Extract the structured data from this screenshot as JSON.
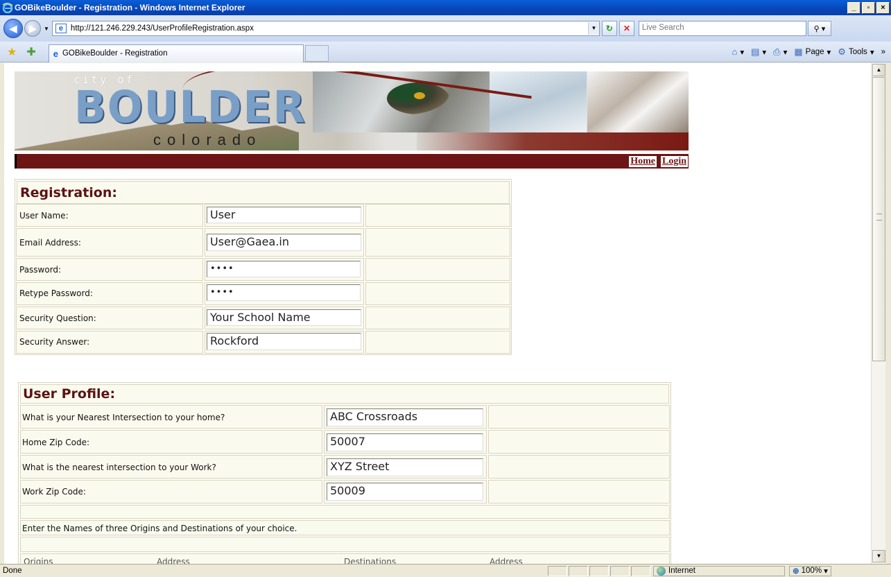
{
  "window": {
    "title": "GOBikeBoulder - Registration - Windows Internet Explorer",
    "minimize": "_",
    "maximize": "▫",
    "close": "×"
  },
  "address_bar": {
    "url": "http://121.246.229.243/UserProfileRegistration.aspx",
    "search_placeholder": "Live Search"
  },
  "tab": {
    "label": "GOBikeBoulder - Registration"
  },
  "command_bar": {
    "page_label": "Page",
    "tools_label": "Tools"
  },
  "banner": {
    "city_of": "city of",
    "name": "BOULDER",
    "state": "colorado"
  },
  "nav": {
    "home": "Home",
    "login": "Login"
  },
  "registration": {
    "title": "Registration:",
    "fields": [
      {
        "label": "User Name:",
        "value": "User"
      },
      {
        "label": "Email Address:",
        "value": "User@Gaea.in"
      },
      {
        "label": "Password:",
        "value": "••••"
      },
      {
        "label": "Retype Password:",
        "value": "••••"
      },
      {
        "label": "Security Question:",
        "value": "Your School Name"
      },
      {
        "label": "Security Answer:",
        "value": "Rockford"
      }
    ]
  },
  "profile": {
    "title": "User Profile:",
    "fields": [
      {
        "label": "What is your Nearest Intersection to your  home?",
        "value": "ABC Crossroads"
      },
      {
        "label": "Home Zip Code:",
        "value": "50007"
      },
      {
        "label": "What is the nearest intersection to your Work?",
        "value": "XYZ Street"
      },
      {
        "label": "Work Zip Code:",
        "value": "50009"
      }
    ],
    "instructions": "Enter the Names of three Origins and Destinations of your choice.",
    "columns": [
      "Origins",
      "Address",
      "Destinations",
      "Address"
    ]
  },
  "status_bar": {
    "status": "Done",
    "zone": "Internet",
    "zoom": "100%"
  }
}
